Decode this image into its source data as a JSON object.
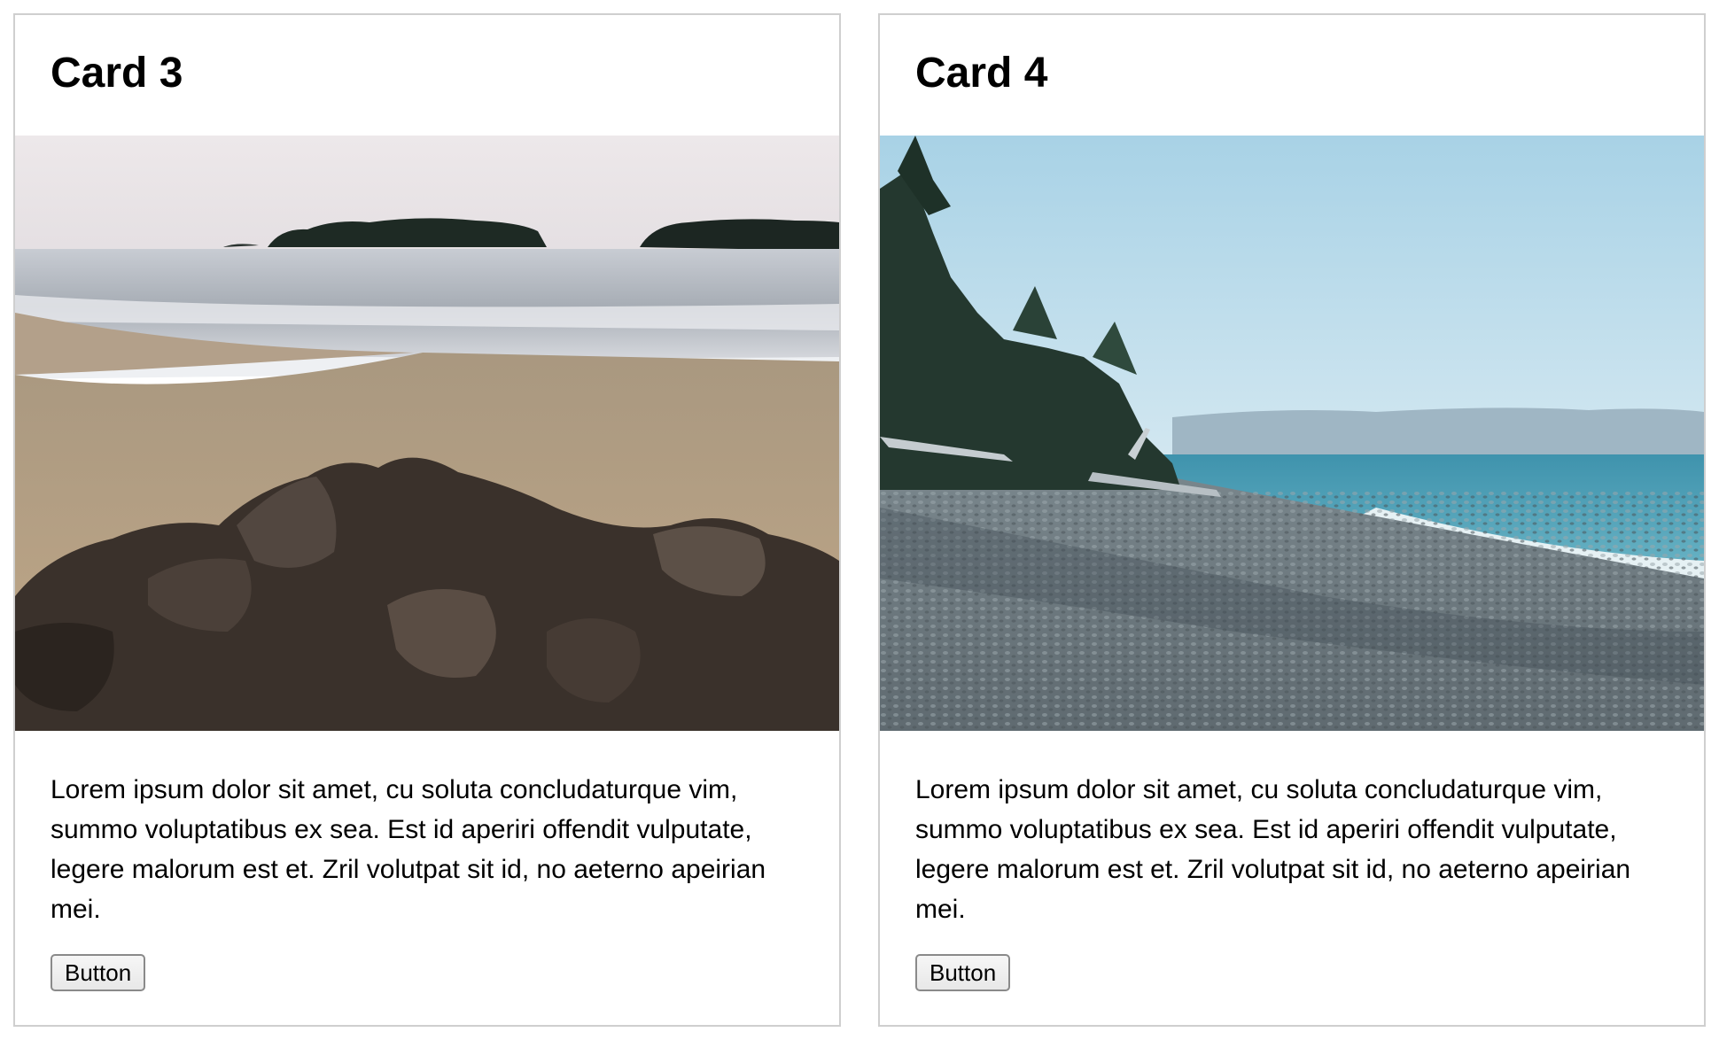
{
  "cards": [
    {
      "title": "Card 3",
      "image_label": "rocky sandy beach with islands",
      "text": "Lorem ipsum dolor sit amet, cu soluta concludaturque vim, summo voluptatibus ex sea. Est id aperiri offendit vulputate, legere malorum est et. Zril volutpat sit id, no aeterno apeirian mei.",
      "button_label": "Button"
    },
    {
      "title": "Card 4",
      "image_label": "pebble beach with evergreen trees and sea",
      "text": "Lorem ipsum dolor sit amet, cu soluta concludaturque vim, summo voluptatibus ex sea. Est id aperiri offendit vulputate, legere malorum est et. Zril volutpat sit id, no aeterno apeirian mei.",
      "button_label": "Button"
    }
  ],
  "colors": {
    "card_border": "#cfcfcf",
    "button_border": "#8a8a8a",
    "button_bg": "#eeeeee"
  }
}
